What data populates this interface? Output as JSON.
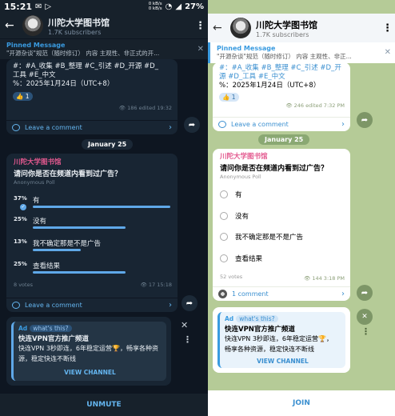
{
  "status": {
    "time": "15:21",
    "net_up": "0 kB/s",
    "net_down": "0 kB/s",
    "battery": "27%"
  },
  "channel": {
    "name": "川陀大学图书馆",
    "subscribers": "1.7K subscribers"
  },
  "pinned": {
    "title": "Pinned Message",
    "dark_text": "\"开源杂谈\"规范（随时修订）   内容 主观性、非正式的开...",
    "light_text": "\"开源杂谈\"规范（随时修订）   内容 主观性、非正..."
  },
  "post1": {
    "dark_tags1": "#：#A_收集 #B_整理 #C_引述 #D_开源 #D_",
    "dark_tags2": "工具 #E_中文",
    "light_tags1": "#：#A_收集 #B_整理 #C_引述 #D_开",
    "light_tags2": "源 #D_工具 #E_中文",
    "date_line": "%：2025年1月24日（UTC+8）",
    "reaction": "👍 1",
    "dark_meta": "👁 186  edited 19:32",
    "light_meta": "👁 246  edited 7:32 PM",
    "comment": "Leave a comment"
  },
  "date_sep": "January 25",
  "poll": {
    "channel": "川陀大学图书馆",
    "question": "请问你是否在频道内看到过广告？",
    "type": "Anonymous Poll",
    "options": [
      {
        "label": "有",
        "pct": "37%",
        "value": 37
      },
      {
        "label": "没有",
        "pct": "25%",
        "value": 25
      },
      {
        "label": "我不确定那是不是广告",
        "pct": "13%",
        "value": 13
      },
      {
        "label": "查看结果",
        "pct": "25%",
        "value": 25
      }
    ],
    "dark_votes": "8 votes",
    "dark_meta": "👁 17  15:18",
    "light_votes": "52 votes",
    "light_meta": "👁 144  3:18 PM",
    "dark_comment": "Leave a comment",
    "light_comment": "1 comment"
  },
  "ad": {
    "tag": "Ad",
    "whats_this": "what's this?",
    "title": "快连VPN官方推广频道",
    "dark_body1": "快连VPN 3秒即连，6年稳定运营🏆，畅享各种资",
    "dark_body2": "源，稳定快连不断线",
    "light_body1": "快连VPN 3秒即连，6年稳定运营🏆，",
    "light_body2": "畅享各种资源，稳定快连不断线",
    "view": "VIEW CHANNEL"
  },
  "dark_bottom": "UNMUTE",
  "light_bottom": "JOIN",
  "colors": {
    "accent": "#3a9be0",
    "poll_bar": "#5fa8e8",
    "channel_name": "#e3598f",
    "dark_bg": "#0e1621",
    "light_bg": "#b5cb97"
  }
}
